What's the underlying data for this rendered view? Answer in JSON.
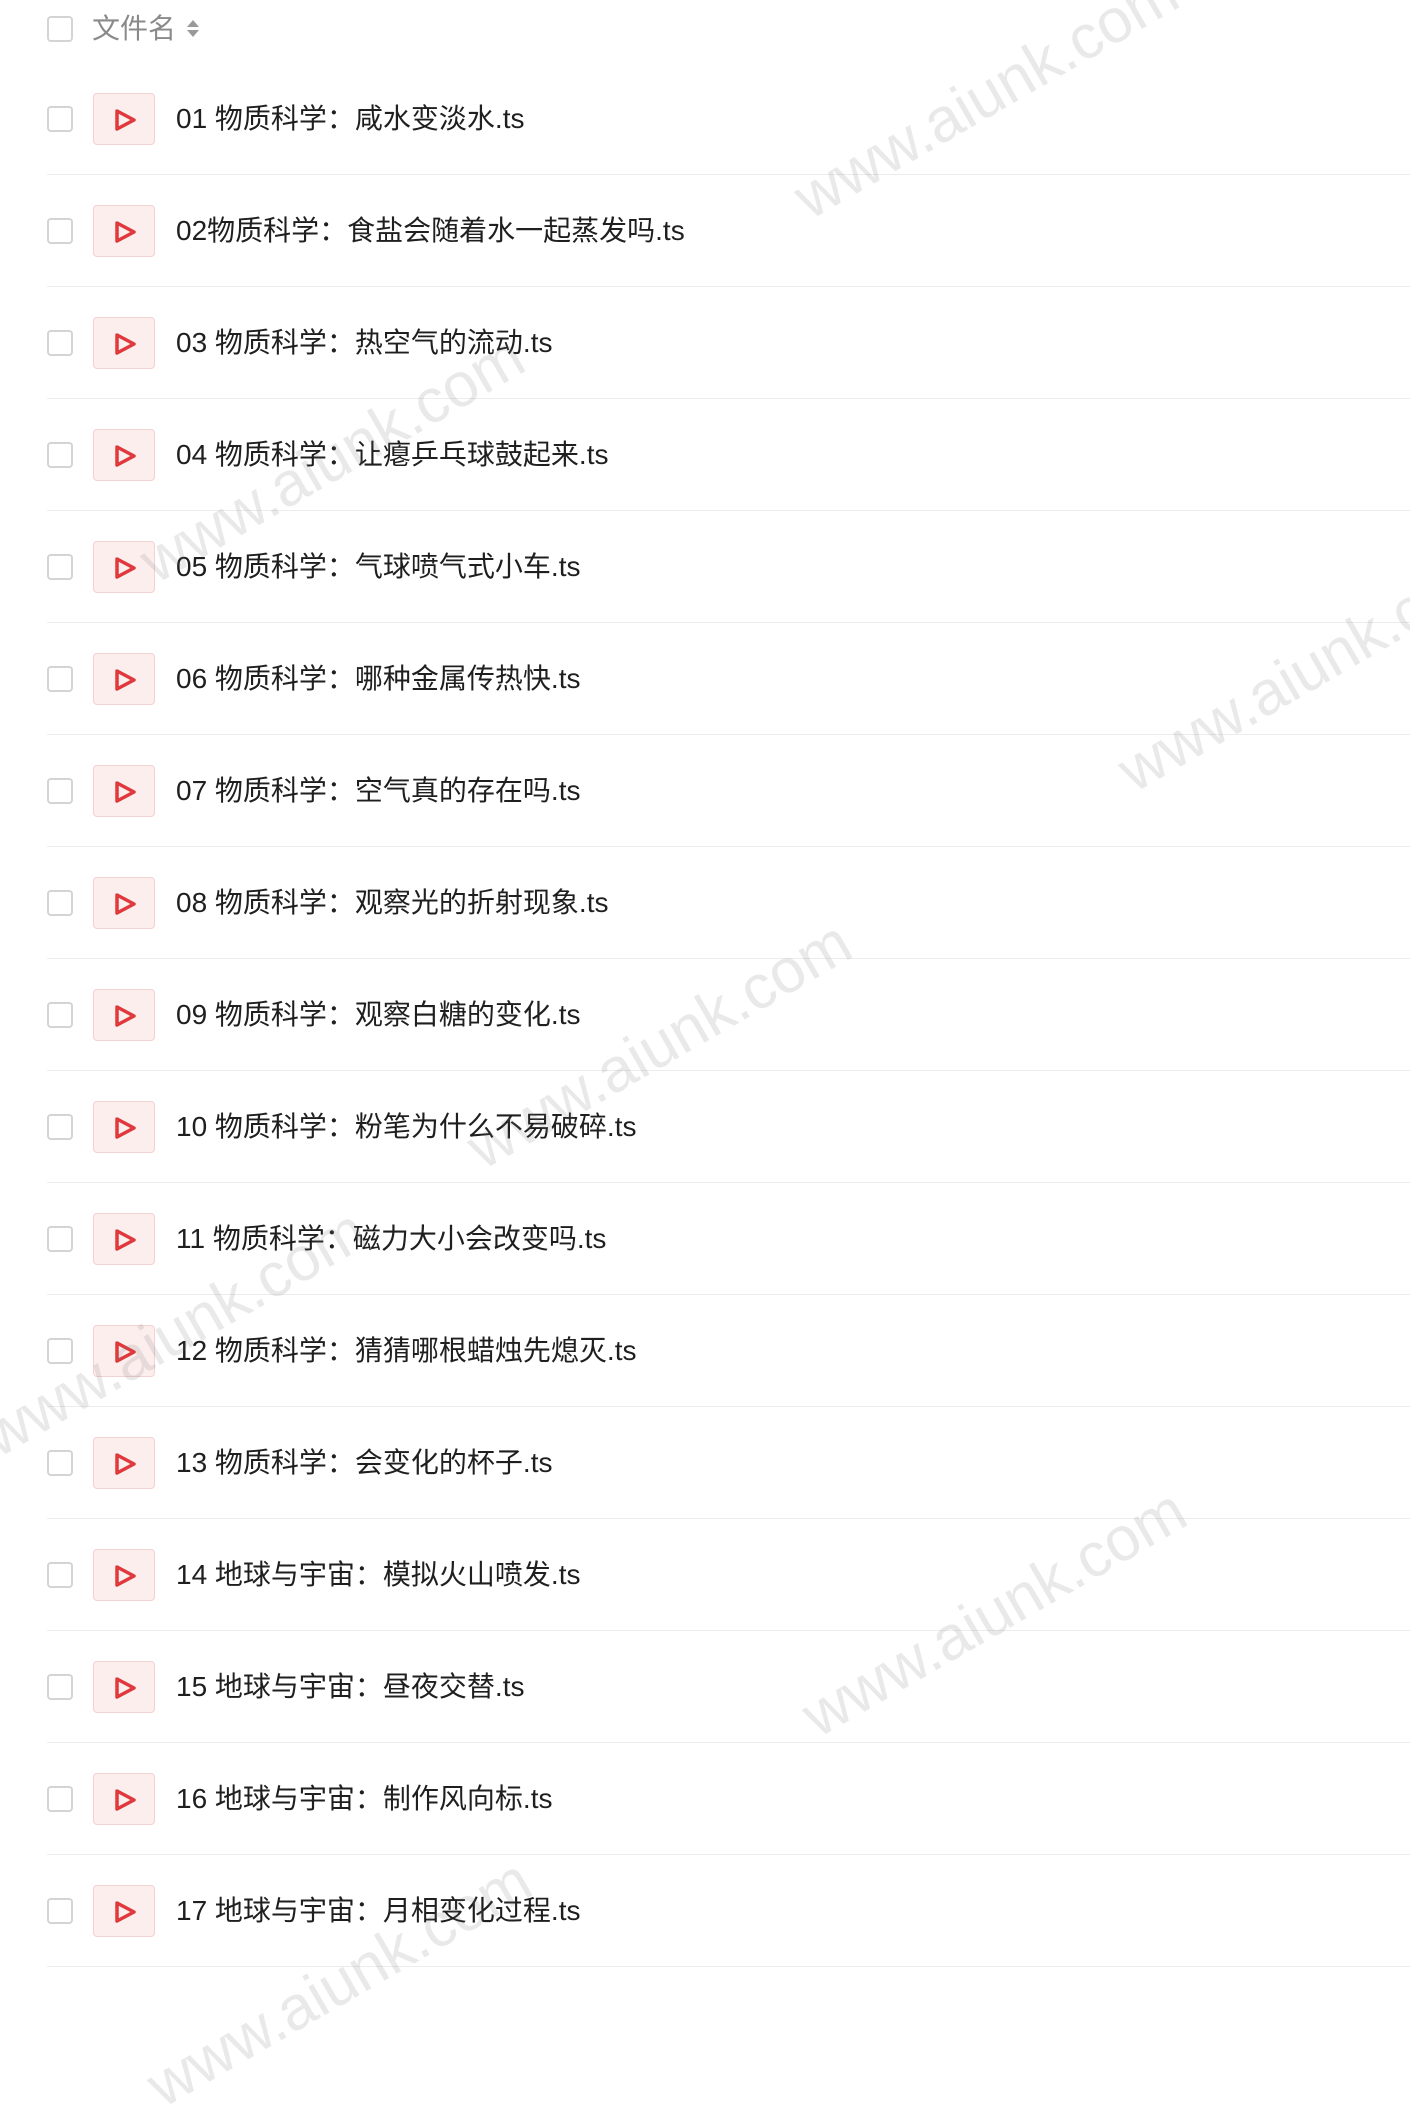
{
  "header": {
    "column_label": "文件名"
  },
  "files": [
    {
      "name": "01 物质科学：咸水变淡水.ts"
    },
    {
      "name": "02物质科学：食盐会随着水一起蒸发吗.ts"
    },
    {
      "name": "03 物质科学：热空气的流动.ts"
    },
    {
      "name": "04 物质科学：让瘪乒乓球鼓起来.ts"
    },
    {
      "name": "05 物质科学：气球喷气式小车.ts"
    },
    {
      "name": "06 物质科学：哪种金属传热快.ts"
    },
    {
      "name": "07 物质科学：空气真的存在吗.ts"
    },
    {
      "name": "08 物质科学：观察光的折射现象.ts"
    },
    {
      "name": "09 物质科学：观察白糖的变化.ts"
    },
    {
      "name": "10 物质科学：粉笔为什么不易破碎.ts"
    },
    {
      "name": "11 物质科学：磁力大小会改变吗.ts"
    },
    {
      "name": "12 物质科学：猜猜哪根蜡烛先熄灭.ts"
    },
    {
      "name": "13 物质科学：会变化的杯子.ts"
    },
    {
      "name": "14 地球与宇宙：模拟火山喷发.ts"
    },
    {
      "name": "15 地球与宇宙：昼夜交替.ts"
    },
    {
      "name": "16 地球与宇宙：制作风向标.ts"
    },
    {
      "name": "17 地球与宇宙：月相变化过程.ts"
    }
  ],
  "icons": {
    "file_type": "play-icon",
    "sort": "sort-icon"
  },
  "colors": {
    "play_icon": "#e0393c",
    "icon_background": "#fdeeee"
  },
  "watermarks": [
    {
      "text": "www.aiunk.com"
    },
    {
      "text": "www.aiunk.com"
    },
    {
      "text": "www.aiunk.com"
    },
    {
      "text": "www.aiunk.com"
    },
    {
      "text": "www.aiunk.com"
    },
    {
      "text": "www.aiunk.com"
    },
    {
      "text": "www.aiunk.com"
    }
  ]
}
